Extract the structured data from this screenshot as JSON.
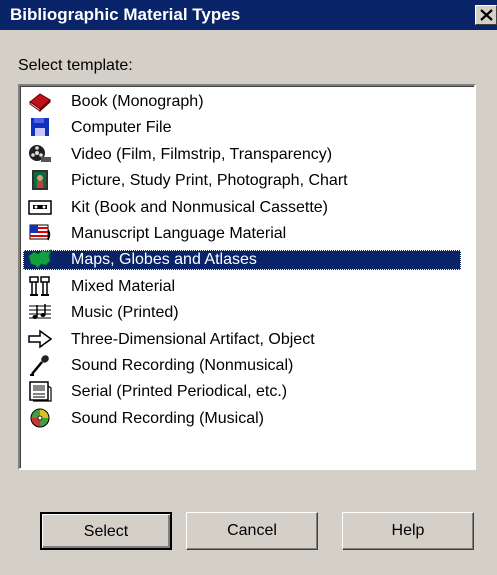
{
  "window": {
    "title": "Bibliographic Material Types"
  },
  "prompt_label": "Select template:",
  "templates": [
    {
      "label": "Book (Monograph)",
      "icon": "book-icon"
    },
    {
      "label": "Computer File",
      "icon": "floppy-disk-icon"
    },
    {
      "label": "Video (Film, Filmstrip, Transparency)",
      "icon": "film-reel-icon"
    },
    {
      "label": "Picture, Study Print, Photograph, Chart",
      "icon": "picture-icon"
    },
    {
      "label": "Kit (Book and Nonmusical Cassette)",
      "icon": "cassette-icon"
    },
    {
      "label": "Manuscript Language Material",
      "icon": "manuscript-flag-icon"
    },
    {
      "label": "Maps, Globes and Atlases",
      "icon": "map-icon",
      "selected": true
    },
    {
      "label": "Mixed Material",
      "icon": "mixed-material-icon"
    },
    {
      "label": "Music (Printed)",
      "icon": "sheet-music-icon"
    },
    {
      "label": "Three-Dimensional Artifact, Object",
      "icon": "arrow-artifact-icon"
    },
    {
      "label": "Sound Recording (Nonmusical)",
      "icon": "microphone-icon"
    },
    {
      "label": "Serial (Printed Periodical, etc.)",
      "icon": "periodical-icon"
    },
    {
      "label": "Sound Recording (Musical)",
      "icon": "compact-disc-icon"
    }
  ],
  "buttons": {
    "select": "Select",
    "cancel": "Cancel",
    "help": "Help"
  },
  "colors": {
    "selection": "#0a246a",
    "face": "#d4d0c8"
  }
}
